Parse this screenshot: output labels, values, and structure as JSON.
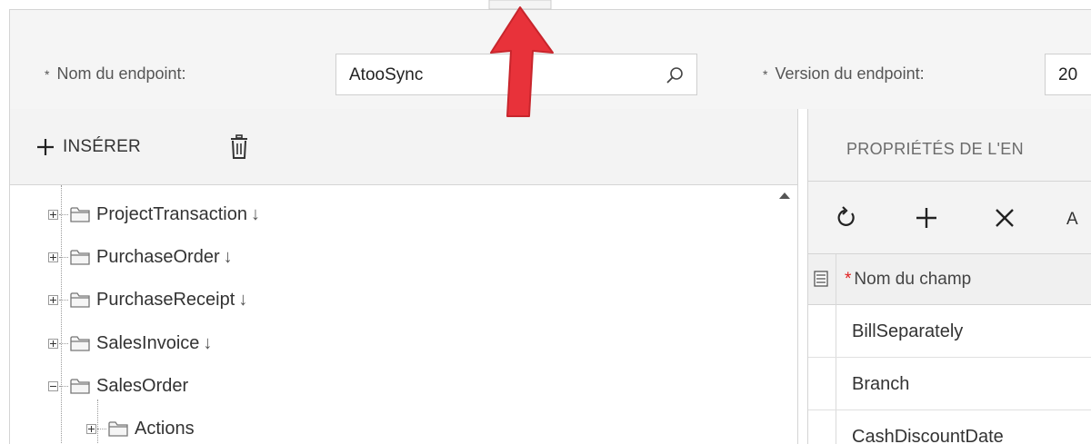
{
  "header": {
    "endpoint_name_label": "Nom du endpoint:",
    "endpoint_name_value": "AtooSync",
    "endpoint_version_label": "Version du endpoint:",
    "endpoint_version_value": "20",
    "required_marker": "*"
  },
  "left_toolbar": {
    "insert_label": "INSÉRER"
  },
  "tree": {
    "items": [
      {
        "label": "ProjectTransaction",
        "arrow": "↓",
        "expanded": false
      },
      {
        "label": "PurchaseOrder",
        "arrow": "↓",
        "expanded": false
      },
      {
        "label": "PurchaseReceipt",
        "arrow": "↓",
        "expanded": false
      },
      {
        "label": "SalesInvoice",
        "arrow": "↓",
        "expanded": false
      },
      {
        "label": "SalesOrder",
        "arrow": "",
        "expanded": true
      },
      {
        "label": "Actions",
        "arrow": "",
        "expanded": false,
        "child": true
      }
    ]
  },
  "right_panel": {
    "title": "PROPRIÉTÉS DE L'EN",
    "toolbar_text": "A",
    "grid": {
      "column_header": "Nom du champ",
      "required_marker": "*",
      "rows": [
        "BillSeparately",
        "Branch",
        "CashDiscountDate"
      ]
    }
  },
  "colors": {
    "accent_arrow": "#e8323a",
    "required_star": "#e02020",
    "panel_bg": "#f3f3f3"
  },
  "icons": [
    "search-icon",
    "plus-icon",
    "trash-icon",
    "folder-icon",
    "refresh-icon",
    "close-icon",
    "column-settings-icon"
  ]
}
